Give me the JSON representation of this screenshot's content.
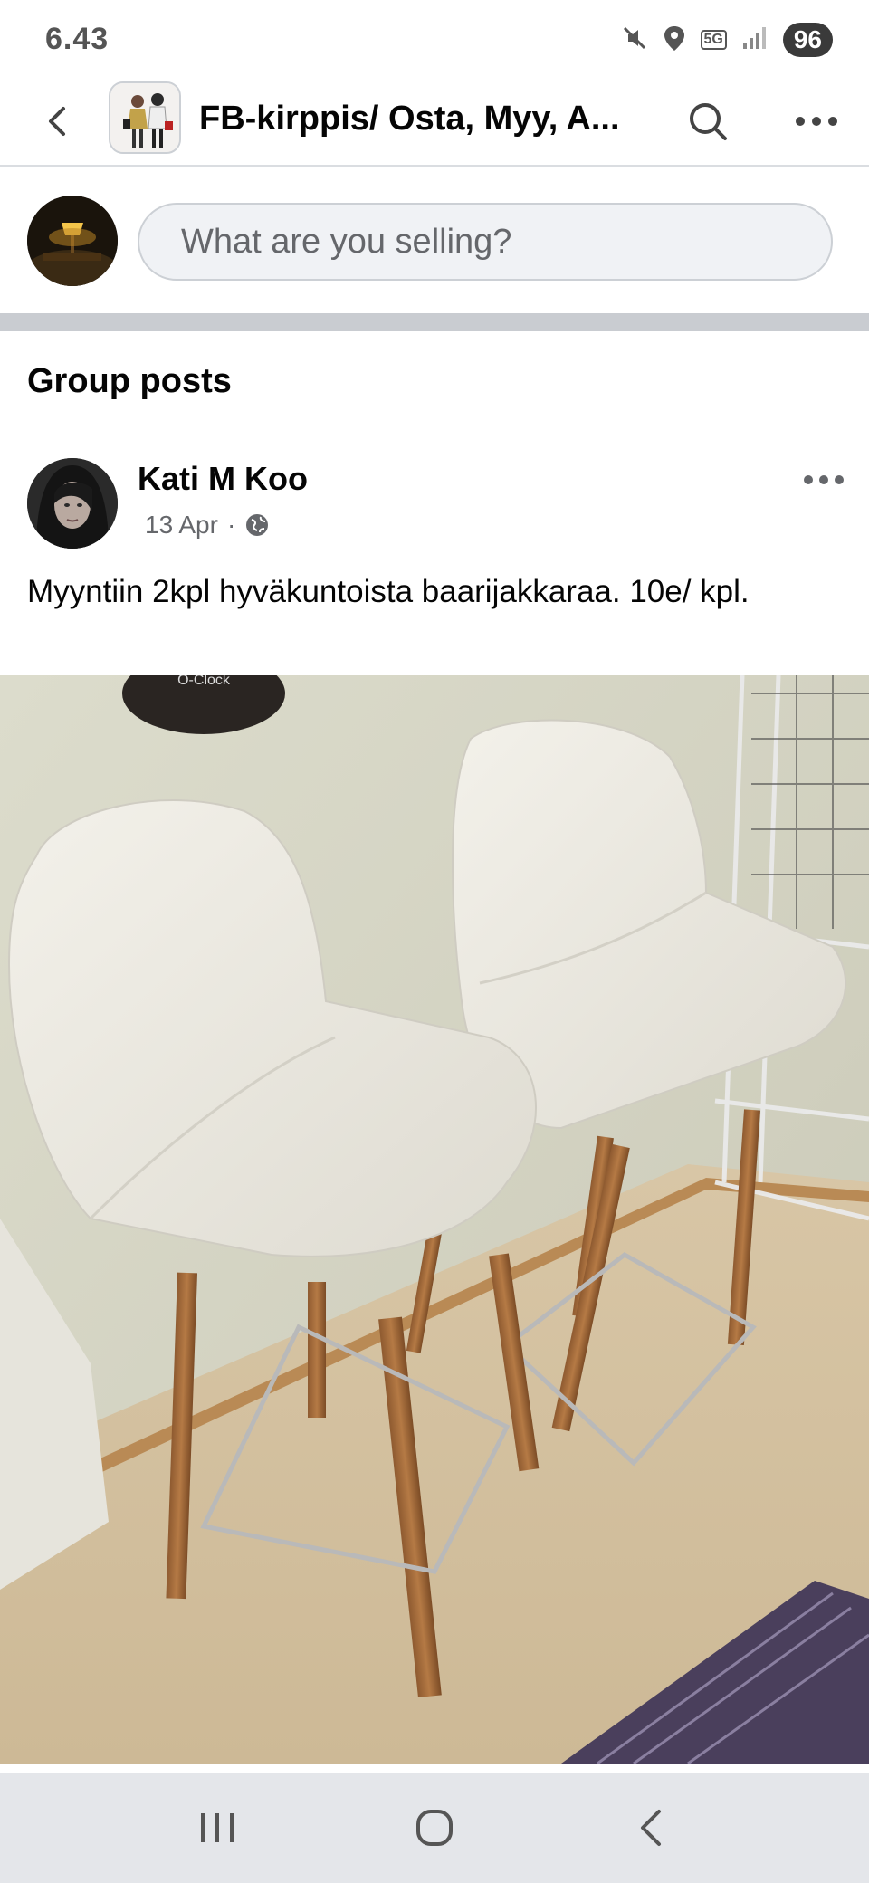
{
  "status_bar": {
    "time": "6.43",
    "network_badge": "5G",
    "battery": "96"
  },
  "app_bar": {
    "group_title": "FB-kirppis/ Osta, Myy, A..."
  },
  "composer": {
    "placeholder": "What are you selling?"
  },
  "section": {
    "title": "Group posts"
  },
  "post": {
    "author": "Kati M Koo",
    "date": "13 Apr",
    "separator": "·",
    "text": "Myyntiin 2kpl  hyväkuntoista baarijakkaraa. 10e/ kpl."
  },
  "photo_overlay": {
    "clock_text": "O-Clock"
  },
  "colors": {
    "text_primary": "#050505",
    "text_secondary": "#65676b",
    "divider": "#c9ccd1",
    "input_bg": "#f0f2f5",
    "nav_bg": "#e4e6ea"
  },
  "icons": {
    "back": "back-arrow-icon",
    "search": "search-icon",
    "more": "more-dots-icon",
    "globe": "globe-icon",
    "mute": "mute-icon",
    "location": "location-icon",
    "signal": "signal-icon",
    "recents": "recent-apps-icon",
    "home": "home-icon",
    "nav_back": "nav-back-icon"
  }
}
